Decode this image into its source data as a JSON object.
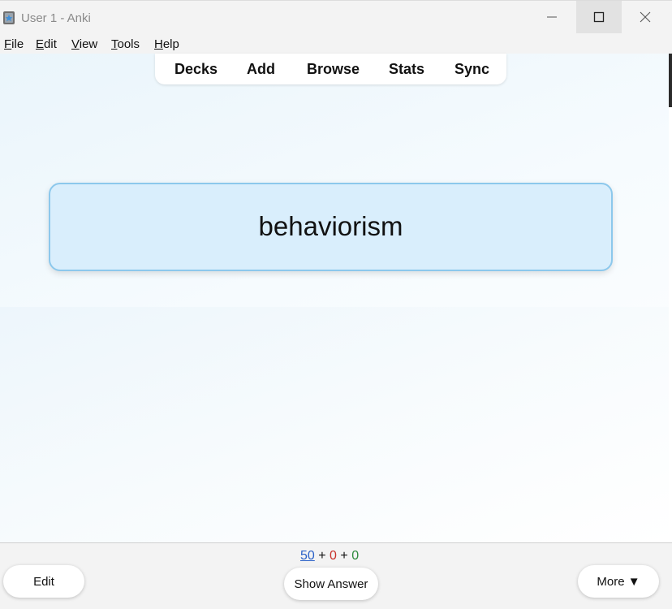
{
  "window": {
    "title": "User 1 - Anki"
  },
  "menu": {
    "items": [
      {
        "label": "File",
        "accel": "F",
        "rest": "ile"
      },
      {
        "label": "Edit",
        "accel": "E",
        "rest": "dit"
      },
      {
        "label": "View",
        "accel": "V",
        "rest": "iew"
      },
      {
        "label": "Tools",
        "accel": "T",
        "rest": "ools"
      },
      {
        "label": "Help",
        "accel": "H",
        "rest": "elp"
      }
    ]
  },
  "toolbar": {
    "decks": "Decks",
    "add": "Add",
    "browse": "Browse",
    "stats": "Stats",
    "sync": "Sync"
  },
  "card": {
    "front": "behaviorism"
  },
  "bottom": {
    "counts": {
      "new": "50",
      "learn": "0",
      "review": "0",
      "separator": "+"
    },
    "edit_label": "Edit",
    "show_answer_label": "Show Answer",
    "more_label": "More ▼"
  },
  "colors": {
    "new_count": "#2b62c8",
    "learn_count": "#c8322b",
    "review_count": "#2d8a3c",
    "card_background": "#d9eefc",
    "card_border": "#8cc8ec"
  },
  "icons": {
    "app": "anki-star-icon",
    "minimize": "minimize-icon",
    "maximize": "maximize-icon",
    "close": "close-icon"
  }
}
